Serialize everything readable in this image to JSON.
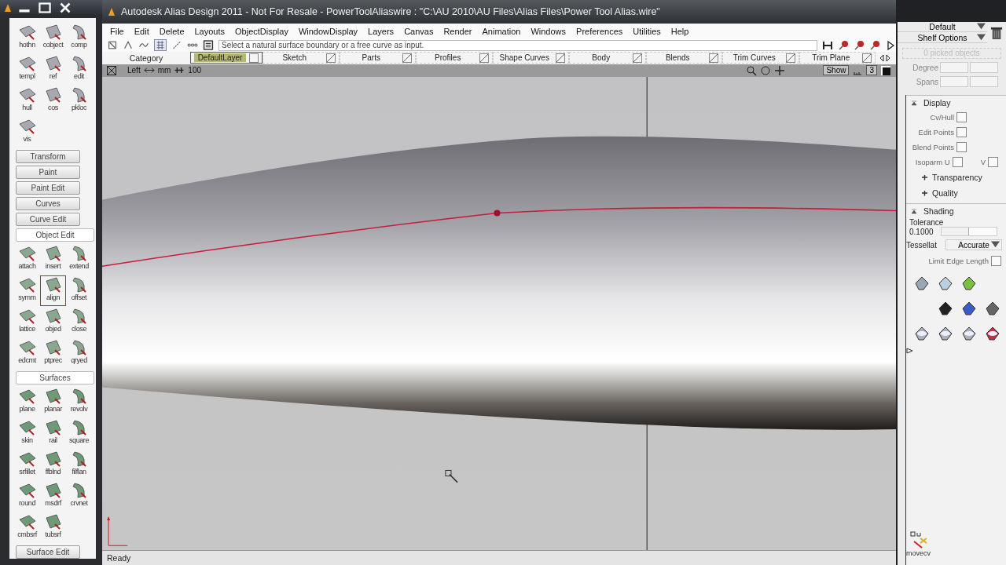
{
  "palette": {
    "items": [
      {
        "kind": "tools",
        "tools": [
          {
            "label": "hothn",
            "selected": false
          },
          {
            "label": "cobject",
            "selected": false
          },
          {
            "label": "comp",
            "selected": false
          },
          {
            "label": "templ",
            "selected": false
          },
          {
            "label": "ref",
            "selected": false
          },
          {
            "label": "edit",
            "selected": false
          },
          {
            "label": "hull",
            "selected": false
          },
          {
            "label": "cos",
            "selected": false
          },
          {
            "label": "pkloc",
            "selected": false
          },
          {
            "label": "vis",
            "selected": false
          }
        ]
      },
      {
        "kind": "tab",
        "title": "Transform",
        "expanded": false
      },
      {
        "kind": "tab",
        "title": "Paint",
        "expanded": false
      },
      {
        "kind": "tab",
        "title": "Paint Edit",
        "expanded": false
      },
      {
        "kind": "tab",
        "title": "Curves",
        "expanded": false
      },
      {
        "kind": "tab",
        "title": "Curve Edit",
        "expanded": false
      },
      {
        "kind": "tab",
        "title": "Object Edit",
        "expanded": true
      },
      {
        "kind": "tools",
        "tools": [
          {
            "label": "attach",
            "selected": false
          },
          {
            "label": "insert",
            "selected": false
          },
          {
            "label": "extend",
            "selected": false
          },
          {
            "label": "symm",
            "selected": false
          },
          {
            "label": "align",
            "selected": true
          },
          {
            "label": "offset",
            "selected": false
          },
          {
            "label": "lattice",
            "selected": false
          },
          {
            "label": "objed",
            "selected": false
          },
          {
            "label": "close",
            "selected": false
          },
          {
            "label": "edcmt",
            "selected": false
          },
          {
            "label": "ptprec",
            "selected": false
          },
          {
            "label": "qryed",
            "selected": false
          }
        ]
      },
      {
        "kind": "tab",
        "title": "Surfaces",
        "expanded": true
      },
      {
        "kind": "tools",
        "tools": [
          {
            "label": "plane",
            "selected": false
          },
          {
            "label": "planar",
            "selected": false
          },
          {
            "label": "revolv",
            "selected": false
          },
          {
            "label": "skin",
            "selected": false
          },
          {
            "label": "rail",
            "selected": false
          },
          {
            "label": "square",
            "selected": false
          },
          {
            "label": "srfillet",
            "selected": false
          },
          {
            "label": "ffblnd",
            "selected": false
          },
          {
            "label": "filflan",
            "selected": false
          },
          {
            "label": "round",
            "selected": false
          },
          {
            "label": "msdrf",
            "selected": false
          },
          {
            "label": "crvnet",
            "selected": false
          },
          {
            "label": "cmbsrf",
            "selected": false
          },
          {
            "label": "tubsrf",
            "selected": false
          }
        ]
      },
      {
        "kind": "tab",
        "title": "Surface Edit",
        "expanded": false
      }
    ]
  },
  "window": {
    "title": "Autodesk Alias Design 2011 - Not For Resale - PowerToolAliaswire : \"C:\\AU 2010\\AU Files\\Alias Files\\Power Tool Alias.wire\""
  },
  "menu": [
    "File",
    "Edit",
    "Delete",
    "Layouts",
    "ObjectDisplay",
    "WindowDisplay",
    "Layers",
    "Canvas",
    "Render",
    "Animation",
    "Windows",
    "Preferences",
    "Utilities",
    "Help"
  ],
  "prompt": {
    "value": "Select a natural surface boundary or a free curve as input."
  },
  "layer_bar": {
    "category": "Category",
    "layers": [
      {
        "name": "DefaultLayer",
        "selected": true
      },
      {
        "name": "Sketch",
        "selected": false
      },
      {
        "name": "Parts",
        "selected": false
      },
      {
        "name": "Profiles",
        "selected": false
      },
      {
        "name": "Shape Curves",
        "selected": false
      },
      {
        "name": "Body",
        "selected": false
      },
      {
        "name": "Blends",
        "selected": false
      },
      {
        "name": "Trim Curves",
        "selected": false
      },
      {
        "name": "Trim Plane",
        "selected": false
      }
    ]
  },
  "viewport": {
    "view": "Left",
    "units": "mm",
    "scale": "100",
    "show": "Show",
    "count": "3"
  },
  "status_bar": "Ready",
  "control_panel": {
    "shelf_set": "Default",
    "shelf_options": "Shelf Options",
    "picked": "0 picked objects",
    "degree": "Degree",
    "spans": "Spans",
    "sections": [
      {
        "title": "Display",
        "expanded": true,
        "rows": [
          {
            "kind": "check",
            "label": "Cv/Hull",
            "checked": false
          },
          {
            "kind": "check",
            "label": "Edit Points",
            "checked": false
          },
          {
            "kind": "check",
            "label": "Blend Points",
            "checked": false
          },
          {
            "kind": "check2",
            "label": "Isoparm U",
            "checked": false,
            "label2": "V",
            "checked2": false
          },
          {
            "kind": "sub",
            "label": "Transparency",
            "expanded": false
          },
          {
            "kind": "sub",
            "label": "Quality",
            "expanded": false
          }
        ]
      },
      {
        "title": "Shading",
        "expanded": true,
        "rows": [
          {
            "kind": "slider",
            "label": "Tolerance",
            "value": "0.1000",
            "level": 0.48
          },
          {
            "kind": "select",
            "label": "Tessellat",
            "value": "Accurate"
          },
          {
            "kind": "check",
            "label": "Limit Edge Length",
            "checked": false
          }
        ]
      }
    ],
    "shelf_tool": "movecv"
  }
}
